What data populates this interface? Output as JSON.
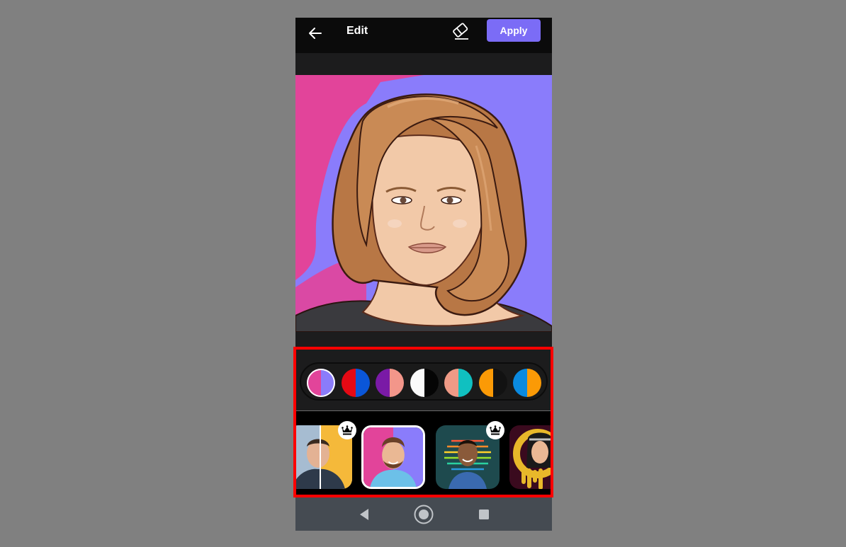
{
  "topbar": {
    "back_icon": "arrow-left-icon",
    "title": "Edit",
    "eraser_icon": "eraser-icon",
    "apply_label": "Apply",
    "apply_color": "#7b6cf6"
  },
  "canvas": {
    "description": "Cartoon portrait of a woman with shoulder-length auburn hair",
    "background_left": "#e2449a",
    "background_right": "#8a7cfb"
  },
  "palette": {
    "selected_index": 0,
    "swatches": [
      {
        "name": "pink-lavender",
        "left": "#e2449a",
        "right": "#8a7cfb"
      },
      {
        "name": "red-blue",
        "left": "#e50914",
        "right": "#0a56d8"
      },
      {
        "name": "purple-salmon",
        "left": "#7a1aa6",
        "right": "#f3968a"
      },
      {
        "name": "white-black",
        "left": "#fafafa",
        "right": "#050505"
      },
      {
        "name": "salmon-teal",
        "left": "#ef9a86",
        "right": "#10c0c0"
      },
      {
        "name": "orange-black",
        "left": "#fb9a06",
        "right": "#121212"
      },
      {
        "name": "blue-orange",
        "left": "#0a8ae0",
        "right": "#fb9a06"
      }
    ]
  },
  "styles": {
    "selected_index": 1,
    "items": [
      {
        "name": "before-after-yellow",
        "premium": true
      },
      {
        "name": "duotone-pop",
        "premium": false
      },
      {
        "name": "neon-rainbow",
        "premium": true
      },
      {
        "name": "gold-drip",
        "premium": false
      }
    ]
  },
  "navbar": {
    "back": "nav-back-icon",
    "home": "nav-home-icon",
    "recents": "nav-recents-icon"
  }
}
